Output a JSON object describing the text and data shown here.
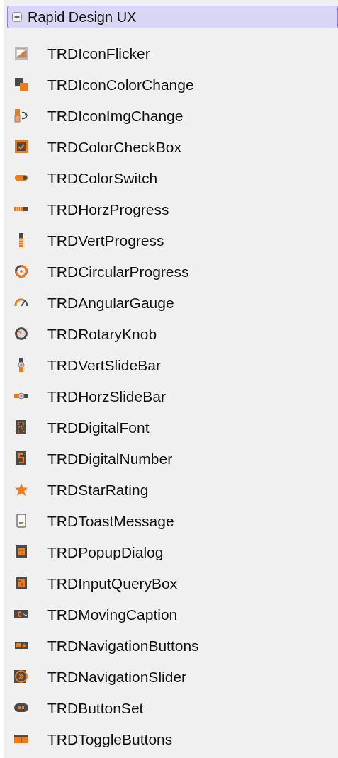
{
  "palette": {
    "title": "Rapid Design UX",
    "expanded": true,
    "items": [
      {
        "label": "TRDIconFlicker"
      },
      {
        "label": "TRDIconColorChange"
      },
      {
        "label": "TRDIconImgChange"
      },
      {
        "label": "TRDColorCheckBox"
      },
      {
        "label": "TRDColorSwitch"
      },
      {
        "label": "TRDHorzProgress"
      },
      {
        "label": "TRDVertProgress"
      },
      {
        "label": "TRDCircularProgress"
      },
      {
        "label": "TRDAngularGauge"
      },
      {
        "label": "TRDRotaryKnob"
      },
      {
        "label": "TRDVertSlideBar"
      },
      {
        "label": "TRDHorzSlideBar"
      },
      {
        "label": "TRDDigitalFont"
      },
      {
        "label": "TRDDigitalNumber"
      },
      {
        "label": "TRDStarRating"
      },
      {
        "label": "TRDToastMessage"
      },
      {
        "label": "TRDPopupDialog"
      },
      {
        "label": "TRDInputQueryBox"
      },
      {
        "label": "TRDMovingCaption"
      },
      {
        "label": "TRDNavigationButtons"
      },
      {
        "label": "TRDNavigationSlider"
      },
      {
        "label": "TRDButtonSet"
      },
      {
        "label": "TRDToggleButtons"
      }
    ]
  }
}
